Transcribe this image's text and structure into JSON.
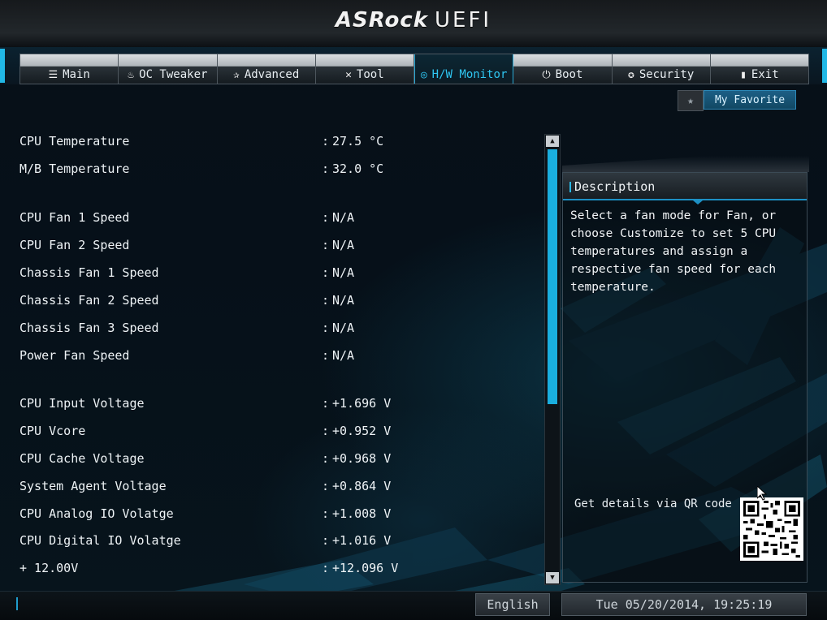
{
  "header": {
    "brand": "ASRock",
    "product": "UEFI"
  },
  "nav": {
    "tabs": [
      {
        "id": "main",
        "label": "Main",
        "icon": "list-icon",
        "glyph": "☰"
      },
      {
        "id": "oc-tweaker",
        "label": "OC Tweaker",
        "icon": "flame-icon",
        "glyph": "♨"
      },
      {
        "id": "advanced",
        "label": "Advanced",
        "icon": "star-icon",
        "glyph": "✰"
      },
      {
        "id": "tool",
        "label": "Tool",
        "icon": "wrench-icon",
        "glyph": "✕"
      },
      {
        "id": "hw-monitor",
        "label": "H/W Monitor",
        "icon": "monitor-icon",
        "glyph": "◎",
        "active": true
      },
      {
        "id": "boot",
        "label": "Boot",
        "icon": "power-icon",
        "glyph": "⏻"
      },
      {
        "id": "security",
        "label": "Security",
        "icon": "shield-icon",
        "glyph": "✪"
      },
      {
        "id": "exit",
        "label": "Exit",
        "icon": "exit-door-icon",
        "glyph": "▮"
      }
    ]
  },
  "favorite": {
    "star": "★",
    "label": "My Favorite"
  },
  "monitor": {
    "separator": ":",
    "rows": [
      {
        "label": "CPU Temperature",
        "value": "27.5 °C"
      },
      {
        "label": "M/B Temperature",
        "value": "32.0 °C"
      },
      {
        "label": "CPU Fan 1 Speed",
        "value": "N/A"
      },
      {
        "label": "CPU Fan 2 Speed",
        "value": "N/A"
      },
      {
        "label": "Chassis Fan 1 Speed",
        "value": "N/A"
      },
      {
        "label": "Chassis Fan 2 Speed",
        "value": "N/A"
      },
      {
        "label": "Chassis Fan 3 Speed",
        "value": "N/A"
      },
      {
        "label": "Power Fan Speed",
        "value": "N/A"
      },
      {
        "label": "CPU Input Voltage",
        "value": "+1.696 V"
      },
      {
        "label": "CPU Vcore",
        "value": "+0.952 V"
      },
      {
        "label": "CPU Cache Voltage",
        "value": "+0.968 V"
      },
      {
        "label": "System Agent Voltage",
        "value": "+0.864 V"
      },
      {
        "label": "CPU Analog IO Volatge",
        "value": "+1.008 V"
      },
      {
        "label": "CPU Digital IO Volatge",
        "value": "+1.016 V"
      },
      {
        "label": "+ 12.00V",
        "value": "+12.096 V"
      }
    ]
  },
  "scrollbar": {
    "up": "▲",
    "down": "▼"
  },
  "description": {
    "title": "Description",
    "text": "Select a fan mode for Fan, or choose Customize to set 5 CPU temperatures and assign a respective fan speed for each temperature.",
    "qr_label": "Get details via QR code"
  },
  "footer": {
    "language": "English",
    "datetime": "Tue 05/20/2014, 19:25:19"
  },
  "colors": {
    "accent": "#1aaede",
    "active_tab_text": "#2fc6f1"
  }
}
